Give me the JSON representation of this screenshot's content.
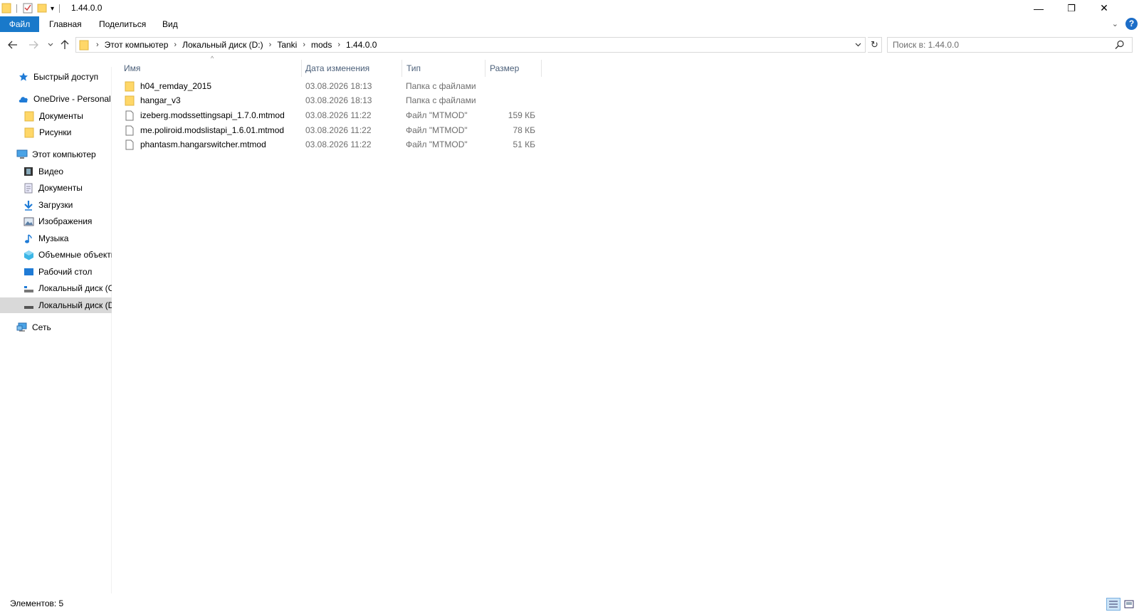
{
  "window": {
    "title": "1.44.0.0",
    "controls": {
      "minimize": "—",
      "restore": "❐",
      "close": "✕"
    }
  },
  "ribbon": {
    "tabs": [
      "Файл",
      "Главная",
      "Поделиться",
      "Вид"
    ],
    "help": "?"
  },
  "address": {
    "crumbs": [
      "Этот компьютер",
      "Локальный диск (D:)",
      "Tanki",
      "mods",
      "1.44.0.0"
    ]
  },
  "search": {
    "placeholder": "Поиск в: 1.44.0.0"
  },
  "sidebar": {
    "items": [
      {
        "label": "Быстрый доступ",
        "icon": "star-icon"
      },
      {
        "label": "OneDrive - Personal",
        "icon": "cloud-icon"
      },
      {
        "label": "Документы",
        "icon": "folder-icon"
      },
      {
        "label": "Рисунки",
        "icon": "folder-icon"
      },
      {
        "label": "Этот компьютер",
        "icon": "computer-icon"
      },
      {
        "label": "Видео",
        "icon": "video-icon"
      },
      {
        "label": "Документы",
        "icon": "documents-icon"
      },
      {
        "label": "Загрузки",
        "icon": "download-icon"
      },
      {
        "label": "Изображения",
        "icon": "pictures-icon"
      },
      {
        "label": "Музыка",
        "icon": "music-icon"
      },
      {
        "label": "Объемные объекты",
        "icon": "3d-objects-icon"
      },
      {
        "label": "Рабочий стол",
        "icon": "desktop-icon"
      },
      {
        "label": "Локальный диск (C:)",
        "icon": "drive-c-icon"
      },
      {
        "label": "Локальный диск (D:)",
        "icon": "drive-d-icon"
      },
      {
        "label": "Сеть",
        "icon": "network-icon"
      }
    ]
  },
  "columns": {
    "name": "Имя",
    "date": "Дата изменения",
    "type": "Тип",
    "size": "Размер"
  },
  "files": [
    {
      "name": "h04_remday_2015",
      "date": "03.08.2026 18:13",
      "type": "Папка с файлами",
      "size": "",
      "icon": "folder-icon"
    },
    {
      "name": "hangar_v3",
      "date": "03.08.2026 18:13",
      "type": "Папка с файлами",
      "size": "",
      "icon": "folder-icon"
    },
    {
      "name": "izeberg.modssettingsapi_1.7.0.mtmod",
      "date": "03.08.2026 11:22",
      "type": "Файл \"MTMOD\"",
      "size": "159 КБ",
      "icon": "file-icon"
    },
    {
      "name": "me.poliroid.modslistapi_1.6.01.mtmod",
      "date": "03.08.2026 11:22",
      "type": "Файл \"MTMOD\"",
      "size": "78 КБ",
      "icon": "file-icon"
    },
    {
      "name": "phantasm.hangarswitcher.mtmod",
      "date": "03.08.2026 11:22",
      "type": "Файл \"MTMOD\"",
      "size": "51 КБ",
      "icon": "file-icon"
    }
  ],
  "status": {
    "text": "Элементов: 5"
  },
  "colors": {
    "accent": "#1979ca",
    "folder": "#ffd768",
    "selected": "#d9d9d9"
  }
}
